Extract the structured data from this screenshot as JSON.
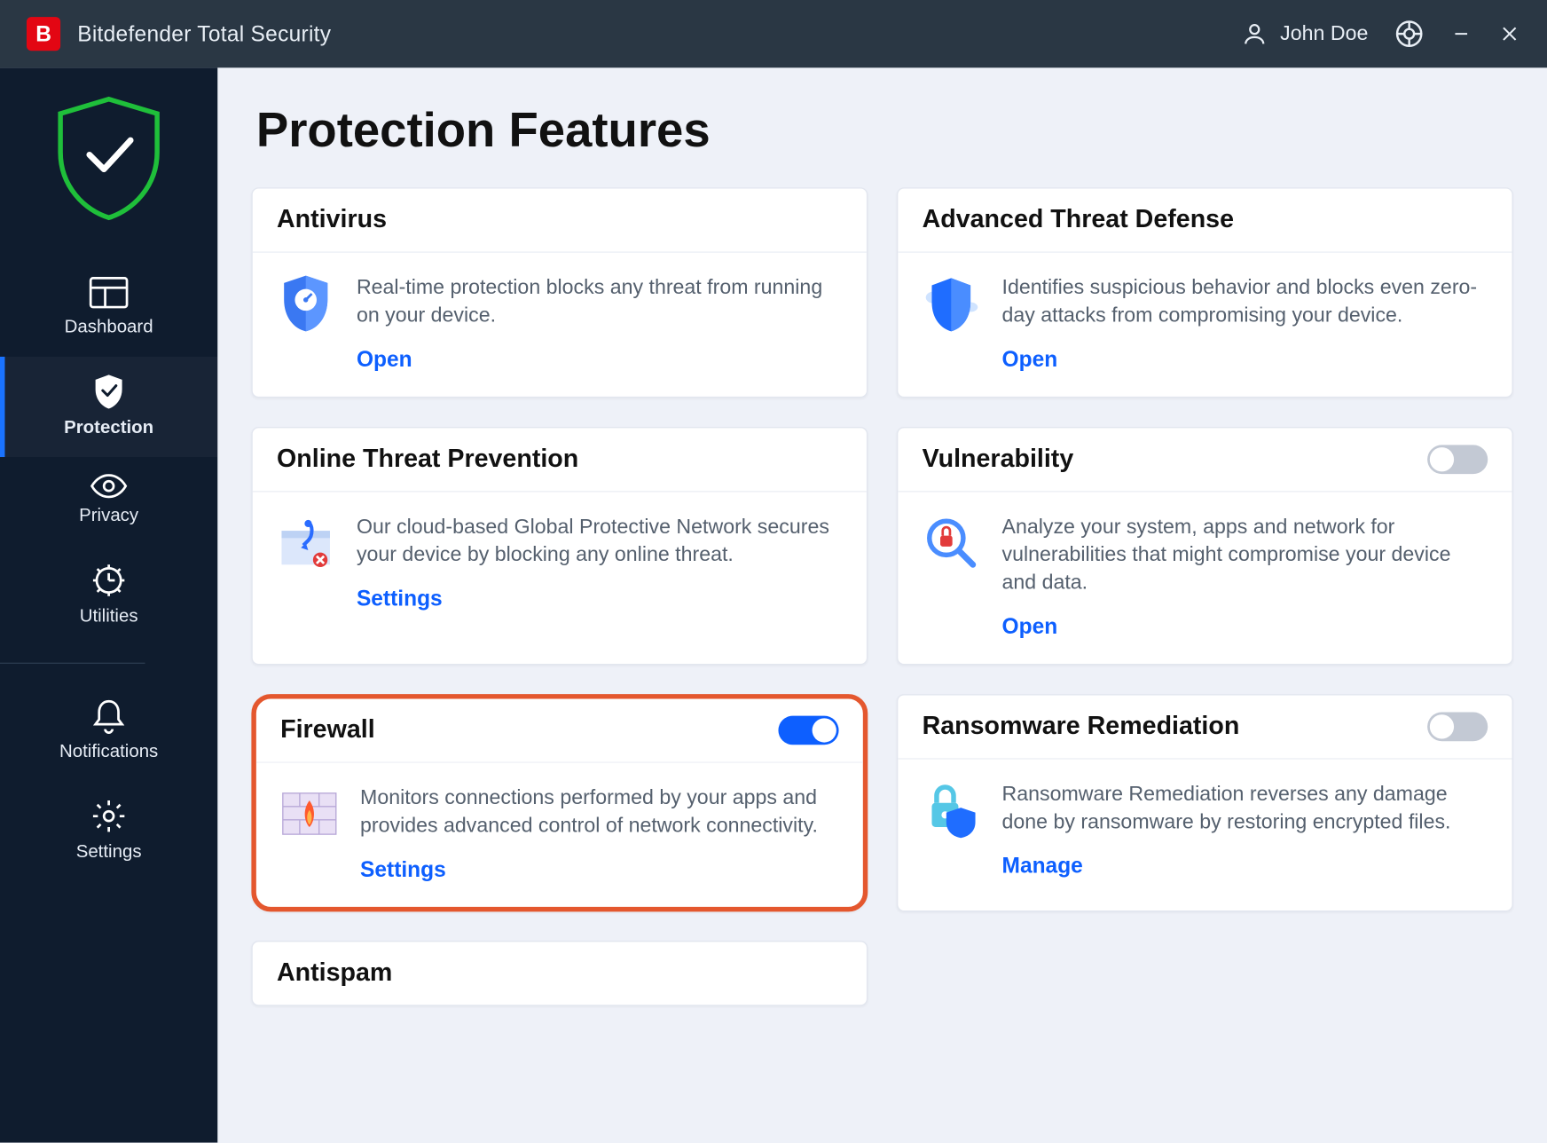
{
  "app": {
    "title": "Bitdefender Total Security",
    "logo_letter": "B"
  },
  "titlebar": {
    "user_name": "John Doe"
  },
  "sidebar": {
    "items": [
      {
        "label": "Dashboard"
      },
      {
        "label": "Protection"
      },
      {
        "label": "Privacy"
      },
      {
        "label": "Utilities"
      },
      {
        "label": "Notifications"
      },
      {
        "label": "Settings"
      }
    ]
  },
  "page": {
    "title": "Protection Features"
  },
  "cards": {
    "antivirus": {
      "title": "Antivirus",
      "desc": "Real-time protection blocks any threat from running on your device.",
      "action": "Open"
    },
    "atd": {
      "title": "Advanced Threat Defense",
      "desc": "Identifies suspicious behavior and blocks even zero-day attacks from compromising your device.",
      "action": "Open"
    },
    "otp": {
      "title": "Online Threat Prevention",
      "desc": "Our cloud-based Global Protective Network secures your device by blocking any online threat.",
      "action": "Settings"
    },
    "vuln": {
      "title": "Vulnerability",
      "desc": "Analyze your system, apps and network for vulnerabilities that might compromise your device and data.",
      "action": "Open"
    },
    "firewall": {
      "title": "Firewall",
      "desc": "Monitors connections performed by your apps and provides advanced control of network connectivity.",
      "action": "Settings"
    },
    "ransom": {
      "title": "Ransomware Remediation",
      "desc": "Ransomware Remediation reverses any damage done by ransomware by restoring encrypted files.",
      "action": "Manage"
    },
    "antispam": {
      "title": "Antispam"
    }
  }
}
